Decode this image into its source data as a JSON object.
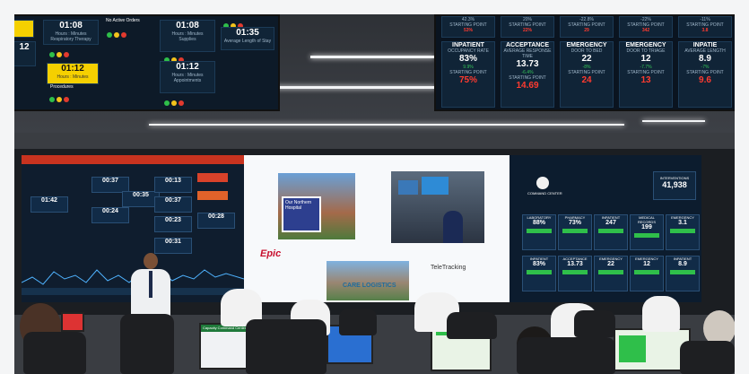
{
  "top_left_screen": {
    "tiles": [
      {
        "time": "01:08",
        "unit": "Hours : Minutes",
        "label": "Respiratory Therapy"
      },
      {
        "time": "01:12",
        "unit": "Hours : Minutes",
        "label": "Procedures"
      },
      {
        "label": "No Active Orders"
      },
      {
        "time": "01:08",
        "unit": "Hours : Minutes",
        "label": "Supplies"
      },
      {
        "time": "01:12",
        "unit": "Hours : Minutes",
        "label": "Appointments"
      },
      {
        "time": "01:35",
        "label": "Average Length of Stay"
      }
    ],
    "edge_values": [
      "12"
    ]
  },
  "top_right_screen": {
    "row1_values": [
      "42.3%",
      "20%",
      "-22.8%",
      "-22%",
      "-11%"
    ],
    "row1_labels": [
      "STARTING POINT",
      "STARTING POINT",
      "STARTING POINT",
      "STARTING POINT",
      "STARTING POINT"
    ],
    "row1_subvalues": [
      "53%",
      "22%",
      "29",
      "342",
      "3.8"
    ],
    "kpis": [
      {
        "title": "INPATIENT",
        "label": "OCCUPANCY RATE",
        "value": "83%",
        "delta": "9.9%",
        "start_label": "STARTING POINT",
        "start": "75%"
      },
      {
        "title": "ACCEPTANCE",
        "label": "AVERAGE RESPONSE TIME",
        "value": "13.73",
        "delta": "-6.4%",
        "start_label": "STARTING POINT",
        "start": "14.69"
      },
      {
        "title": "EMERGENCY",
        "label": "DOOR TO BED",
        "value": "22",
        "delta": "-8%",
        "start_label": "STARTING POINT",
        "start": "24"
      },
      {
        "title": "EMERGENCY",
        "label": "DOOR TO TRIAGE",
        "value": "12",
        "delta": "-7.7%",
        "start_label": "STARTING POINT",
        "start": "13"
      },
      {
        "title": "INPATIE",
        "label": "AVERAGE LENGTH",
        "value": "8.9",
        "delta": "-7%",
        "start_label": "STARTING POINT",
        "start": "9.6"
      }
    ]
  },
  "video_wall": {
    "left_tiles": [
      "00:37",
      "00:24",
      "00:35",
      "00:13",
      "00:37",
      "00:23",
      "00:31",
      "00:28",
      "01:42"
    ],
    "center": {
      "brand1": "Epic",
      "brand2": "TeleTracking",
      "brand3": "CARE LOGISTICS",
      "hospital_sign": "Our Northern Hospital"
    },
    "right": {
      "big_label": "INTERVENTIONS",
      "big_value": "41,938",
      "heading": "COMMAND CENTER",
      "row1": [
        {
          "t": "LABORATORY",
          "v": "88%"
        },
        {
          "t": "PHARMACY",
          "v": "73%"
        },
        {
          "t": "INPATIENT",
          "v": "247"
        },
        {
          "t": "MEDICAL RECORDS",
          "v": "199"
        },
        {
          "t": "EMERGENCY",
          "v": "3.1"
        }
      ],
      "row2": [
        {
          "t": "INPATIENT",
          "v": "83%"
        },
        {
          "t": "ACCEPTANCE",
          "v": "13.73"
        },
        {
          "t": "EMERGENCY",
          "v": "22"
        },
        {
          "t": "EMERGENCY",
          "v": "12"
        },
        {
          "t": "INPATIENT",
          "v": "8.9"
        }
      ]
    }
  },
  "desk_monitor": {
    "title": "Capacity Command Center"
  },
  "colors": {
    "accent_red": "#e23a2e",
    "accent_green": "#2fbf4a",
    "accent_yellow": "#f3c31b",
    "panel_navy": "#0f1d2e"
  }
}
